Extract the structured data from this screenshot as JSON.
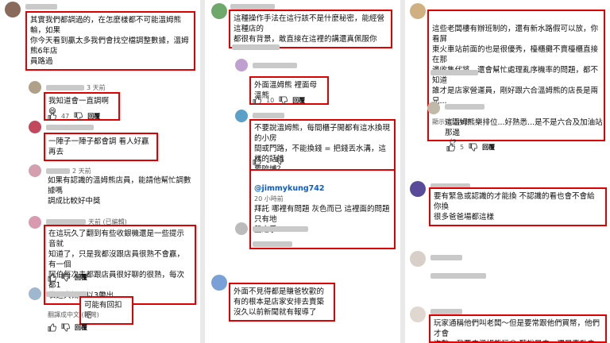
{
  "col1": {
    "c1": {
      "text": "其實我們都調過的，在怎麼樣都不可能溫姆熊輸，如果\n你今天看到贏太多我們會找空檔調整數據，溫姆熊6年店\n員路過"
    },
    "c2": {
      "meta": "3 天前",
      "text": "我知道會一直調啊😄",
      "likes": "47"
    },
    "c3": {
      "text": "一陣子一陣子都會調 看人好贏再去"
    },
    "c4": {
      "meta": "2 天前",
      "text": "如果有認識的溫姆熊店員，能請他幫忙調數據嗎\n調成比較好中獎"
    },
    "c5": {
      "meta": "天前 (已編輯)",
      "text": "在這玩久了翻到有些收銀機還是一些提示音就\n知道了，只是我都沒跟店員很熟不會贏，有一個\n阿伯每次去都跟店員很好聊的很熟，每次都1\n袋進大概可以3帶出"
    },
    "c6": {
      "text": "可能有回扣吧"
    },
    "c7": {
      "translate": "翻譯成中文 (台灣)"
    }
  },
  "col2": {
    "c1": {
      "text": "這種操作手法在這行該不是什麼秘密，能經營這種店的\n都很有背景，敢直接在這裡的講還真佩服你"
    },
    "c2": {
      "text": "外面溫姆熊 裡面母溫熊",
      "likes": "10"
    },
    "c3": {
      "text": "不要說溫姆熊，每間櫃子開都有這水換現的小房\n間或門路，不能換錢 = 把錢丟水溝，這樣的話誰\n要陪博？",
      "likes": "1"
    },
    "c4": {
      "handle": "@jimmykung742",
      "time": "20 小時前",
      "text": "拜託 哪裡有問題 灰色而已 這裡面的問題只有地\n盤之爭"
    },
    "c5": {
      "text": "外面不見得都是賺爸牧歡的\n有的根本是店家安排去賣築\n沒久以前新聞就有報導了"
    }
  },
  "col3": {
    "c1": {
      "text": "這些老闆樓有辦班制的，還有新水路假可以放，你看屏\n東火車站前面的也是很優秀，檯櫃攤不賣檯櫃直接在那\n邊收售代將，還會幫忙處理亂序機率的問題，都不知道\n誰才是店家營運員，剛好跟六合溫姆熊的店長是兩兄...",
      "more": "顯示完整內容"
    },
    "c2": {
      "text": "這溫姆熊樂排位...好熟悉...是不是六合及加油站那邊\n（？",
      "likes": "5"
    },
    "c3": {
      "text": "要有緊急或認識的才能換 不認識的看也會不會給你換\n很多爸爸場都這樣"
    },
    "c4": {
      "text": "玩家通稱他們叫老闆～但是要常跟他們買幣，他們才會\n次數一我要去溫姆熊玩😄 聽說是去，還是專動去是你"
    },
    "colors": {
      "box": "#e00000",
      "meta": "#606060"
    }
  }
}
